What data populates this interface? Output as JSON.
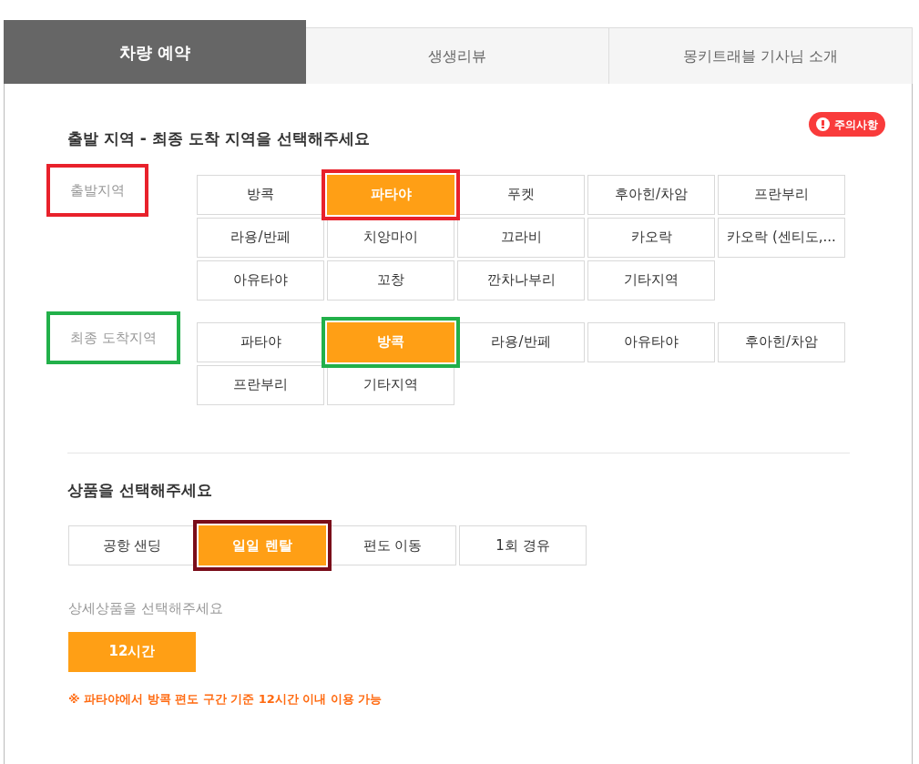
{
  "tabs": [
    {
      "label": "차량 예약",
      "selected": true
    },
    {
      "label": "생생리뷰",
      "selected": false
    },
    {
      "label": "몽키트래블 기사님 소개",
      "selected": false
    }
  ],
  "notice_badge": {
    "label": "주의사항"
  },
  "region_title": "출발 지역 - 최종 도착 지역을 선택해주세요",
  "region_groups": [
    {
      "label": "출발지역",
      "color": "#e8212b",
      "options": [
        {
          "label": "방콕",
          "selected": false
        },
        {
          "label": "파타야",
          "selected": true
        },
        {
          "label": "푸켓",
          "selected": false
        },
        {
          "label": "후아힌/차암",
          "selected": false
        },
        {
          "label": "프란부리",
          "selected": false
        },
        {
          "label": "라용/반페",
          "selected": false
        },
        {
          "label": "치앙마이",
          "selected": false
        },
        {
          "label": "끄라비",
          "selected": false
        },
        {
          "label": "카오락",
          "selected": false
        },
        {
          "label": "카오락 (센티도,...",
          "selected": false
        },
        {
          "label": "아유타야",
          "selected": false
        },
        {
          "label": "꼬창",
          "selected": false
        },
        {
          "label": "깐차나부리",
          "selected": false
        },
        {
          "label": "기타지역",
          "selected": false
        }
      ]
    },
    {
      "label": "최종 도착지역",
      "color": "#22b04a",
      "options": [
        {
          "label": "파타야",
          "selected": false
        },
        {
          "label": "방콕",
          "selected": true
        },
        {
          "label": "라용/반페",
          "selected": false
        },
        {
          "label": "아유타야",
          "selected": false
        },
        {
          "label": "후아힌/차암",
          "selected": false
        },
        {
          "label": "프란부리",
          "selected": false
        },
        {
          "label": "기타지역",
          "selected": false
        }
      ]
    }
  ],
  "product_title": "상품을 선택해주세요",
  "products": {
    "color": "#7a0d1a",
    "options": [
      {
        "label": "공항 샌딩",
        "selected": false
      },
      {
        "label": "일일 렌탈",
        "selected": true
      },
      {
        "label": "편도 이동",
        "selected": false
      },
      {
        "label": "1회 경유",
        "selected": false
      }
    ]
  },
  "detail_title": "상세상품을 선택해주세요",
  "detail_options": [
    {
      "label": "12시간",
      "selected": true
    }
  ],
  "note": "※ 파타야에서 방콕 편도 구간 기준 12시간 이내 이용 가능"
}
